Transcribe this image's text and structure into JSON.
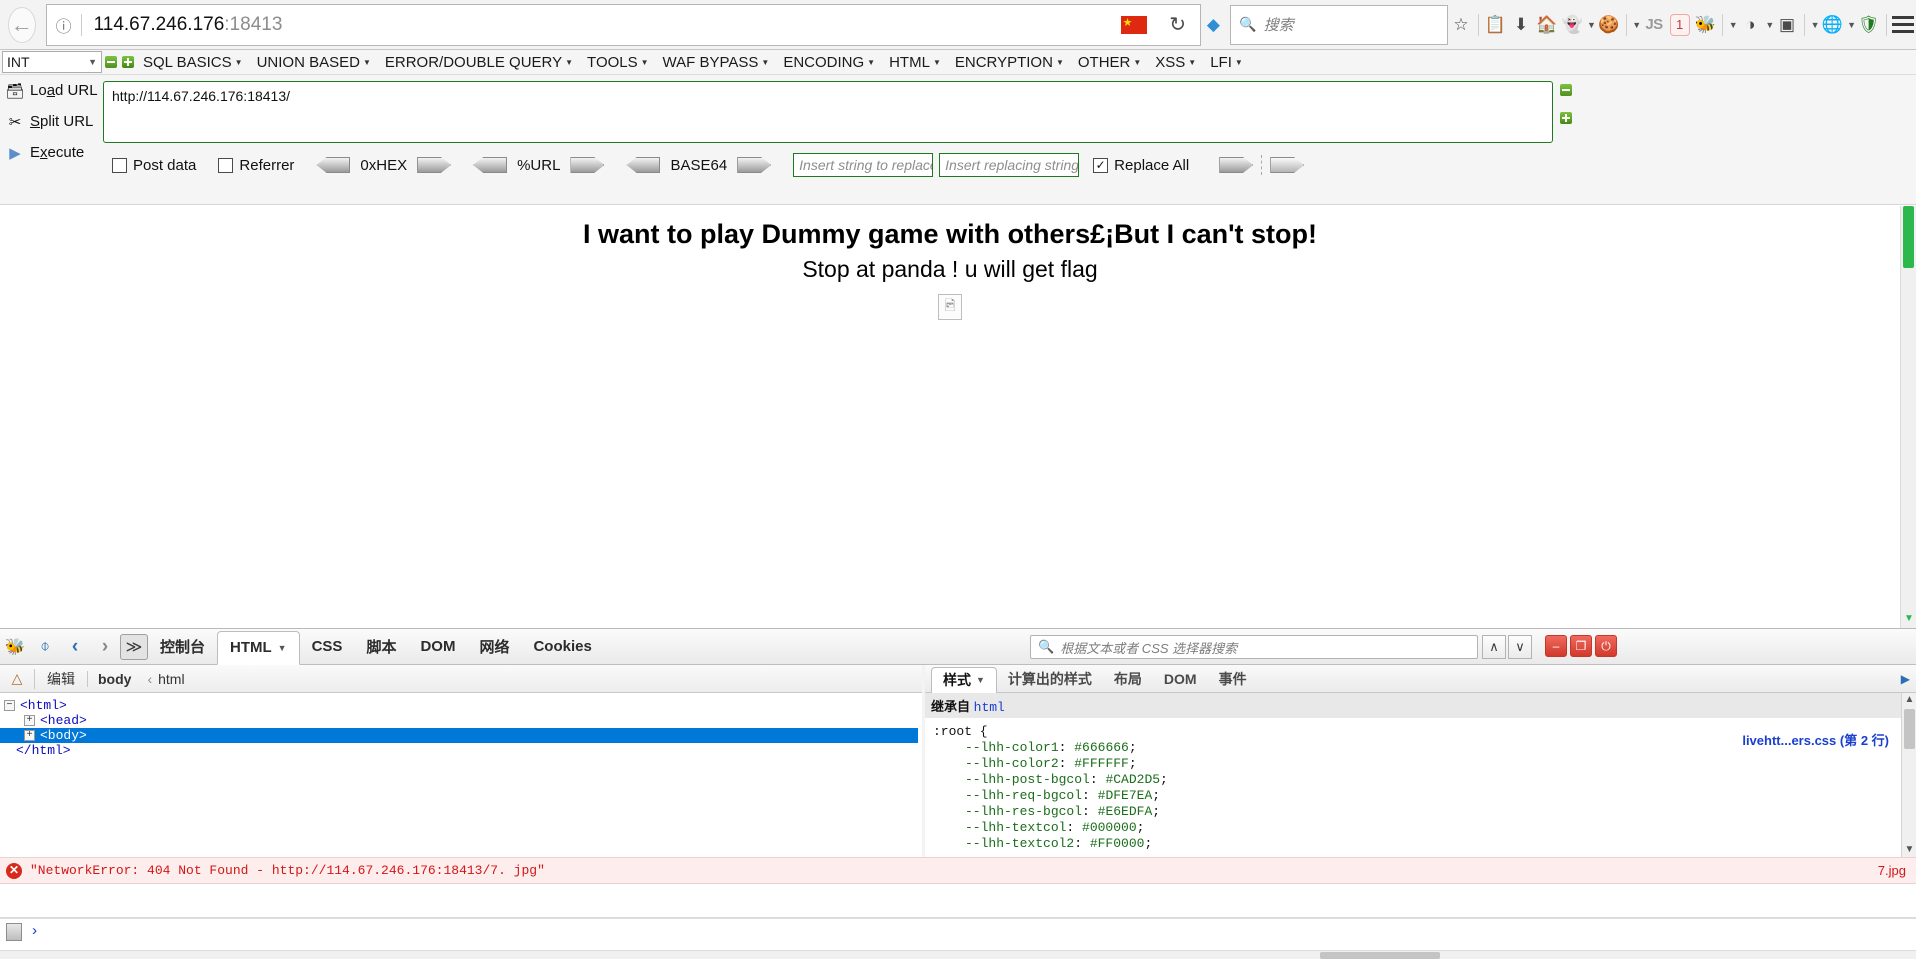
{
  "browser": {
    "back_icon": "back-arrow-icon",
    "identity_icon": "info-icon",
    "url_host": "114.67.246.176",
    "url_port": ":18413",
    "flag_icon": "china-flag-icon",
    "reload_icon": "reload-icon",
    "toolbar_icons": [
      {
        "name": "shield-blue-icon",
        "glyph": "◆"
      },
      {
        "name": "bookmark-star-icon",
        "glyph": "☆"
      },
      {
        "name": "reader-list-icon",
        "glyph": "≣"
      },
      {
        "name": "download-icon",
        "glyph": "⬇"
      },
      {
        "name": "home-icon",
        "glyph": "⌂"
      },
      {
        "name": "ghostery-icon",
        "glyph": "●"
      },
      {
        "name": "cookie-icon",
        "glyph": "●"
      },
      {
        "name": "noscript-icon",
        "glyph": "JS"
      },
      {
        "name": "firebug-bug-icon",
        "glyph": "●"
      },
      {
        "name": "tamper-icon",
        "glyph": "●"
      },
      {
        "name": "proxy-switch-icon",
        "glyph": "□"
      },
      {
        "name": "globe-icon",
        "glyph": "●"
      },
      {
        "name": "adblock-shield-icon",
        "glyph": "●"
      },
      {
        "name": "menu-hamburger-icon",
        "glyph": "☰"
      }
    ],
    "badge_count": "1",
    "js_label": "JS",
    "search": {
      "icon": "search-icon",
      "placeholder": "搜索"
    }
  },
  "hackbar": {
    "encoding_select": "INT",
    "remove_icon": "minus-square-icon",
    "add_icon": "plus-square-icon",
    "menus": [
      "SQL BASICS",
      "UNION BASED",
      "ERROR/DOUBLE QUERY",
      "TOOLS",
      "WAF BYPASS",
      "ENCODING",
      "HTML",
      "ENCRYPTION",
      "OTHER",
      "XSS",
      "LFI"
    ],
    "actions": [
      {
        "icon": "load-url-icon",
        "glyph": "🖿",
        "label_pre": "Lo",
        "label_underline": "a",
        "label_post": "d URL"
      },
      {
        "icon": "split-url-icon",
        "glyph": "✂",
        "label_pre": "",
        "label_underline": "S",
        "label_post": "plit URL"
      },
      {
        "icon": "execute-icon",
        "glyph": "▶",
        "label_pre": "E",
        "label_underline": "x",
        "label_post": "ecute"
      }
    ],
    "url_value": "http://114.67.246.176:18413/",
    "options": {
      "post_data_label": "Post data",
      "post_data_checked": false,
      "referrer_label": "Referrer",
      "referrer_checked": false,
      "encoders": [
        "0xHEX",
        "%URL",
        "BASE64"
      ],
      "replace_placeholder": "Insert string to replace",
      "replacing_placeholder": "Insert replacing string",
      "replace_all_label": "Replace All",
      "replace_all_checked": true
    }
  },
  "page": {
    "heading1": "I want to play Dummy game with others£¡But I can't stop!",
    "heading2": "Stop at panda ! u will get flag",
    "broken_image_icon": "broken-image-icon"
  },
  "devtools": {
    "icons": [
      {
        "name": "firebug-icon",
        "glyph": "●"
      },
      {
        "name": "inspect-element-icon",
        "glyph": "↖"
      },
      {
        "name": "history-back-icon",
        "glyph": "‹"
      },
      {
        "name": "history-forward-icon",
        "glyph": "›"
      },
      {
        "name": "console-toggle-icon",
        "glyph": "≫"
      }
    ],
    "tabs": [
      {
        "label": "控制台",
        "selected": false
      },
      {
        "label": "HTML",
        "selected": true
      },
      {
        "label": "CSS",
        "selected": false
      },
      {
        "label": "脚本",
        "selected": false
      },
      {
        "label": "DOM",
        "selected": false
      },
      {
        "label": "网络",
        "selected": false
      },
      {
        "label": "Cookies",
        "selected": false
      }
    ],
    "search": {
      "icon": "search-icon",
      "placeholder": "根据文本或者 CSS 选择器搜索"
    },
    "nav_up": "∧",
    "nav_down": "∨",
    "window_buttons": [
      {
        "name": "minimize-button",
        "glyph": "–"
      },
      {
        "name": "restore-button",
        "glyph": "❐"
      },
      {
        "name": "close-button",
        "glyph": "⏻"
      }
    ],
    "breadcrumb": {
      "toolbar_icon": "firebug-small-icon",
      "edit_label": "编辑",
      "current": "body",
      "sep": "‹",
      "parent": "html"
    },
    "html_tree": [
      {
        "indent": 0,
        "twisty": "-",
        "text": "<html>",
        "selected": false
      },
      {
        "indent": 1,
        "twisty": "+",
        "text": "<head>",
        "selected": false
      },
      {
        "indent": 1,
        "twisty": "+",
        "text": "<body>",
        "selected": true
      },
      {
        "indent": 0,
        "twisty": "",
        "text": "</html>",
        "selected": false
      }
    ],
    "style_tabs": [
      {
        "label": "样式",
        "selected": true,
        "caret": true
      },
      {
        "label": "计算出的样式",
        "selected": false
      },
      {
        "label": "布局",
        "selected": false
      },
      {
        "label": "DOM",
        "selected": false
      },
      {
        "label": "事件",
        "selected": false
      }
    ],
    "css_panel": {
      "inherit_label": "继承自",
      "inherit_from": "html",
      "selector": ":root {",
      "source_link": "livehtt...ers.css (第 2 行)",
      "declarations": [
        {
          "prop": "--lhh-color1",
          "value": "#666666"
        },
        {
          "prop": "--lhh-color2",
          "value": "#FFFFFF"
        },
        {
          "prop": "--lhh-post-bgcol",
          "value": "#CAD2D5"
        },
        {
          "prop": "--lhh-req-bgcol",
          "value": "#DFE7EA"
        },
        {
          "prop": "--lhh-res-bgcol",
          "value": "#E6EDFA"
        },
        {
          "prop": "--lhh-textcol",
          "value": "#000000"
        },
        {
          "prop": "--lhh-textcol2",
          "value": "#FF0000"
        }
      ]
    },
    "error": {
      "icon": "error-circle-icon",
      "message": "\"NetworkError: 404 Not Found - http://114.67.246.176:18413/7. jpg\"",
      "source": "7.jpg"
    },
    "console_prompt": "›",
    "console_icon": "console-lines-icon"
  },
  "colors": {
    "accent_green": "#1f7a1f",
    "selection_blue": "#0078d7",
    "error_red": "#d41616",
    "link_blue": "#1a3fd0"
  }
}
